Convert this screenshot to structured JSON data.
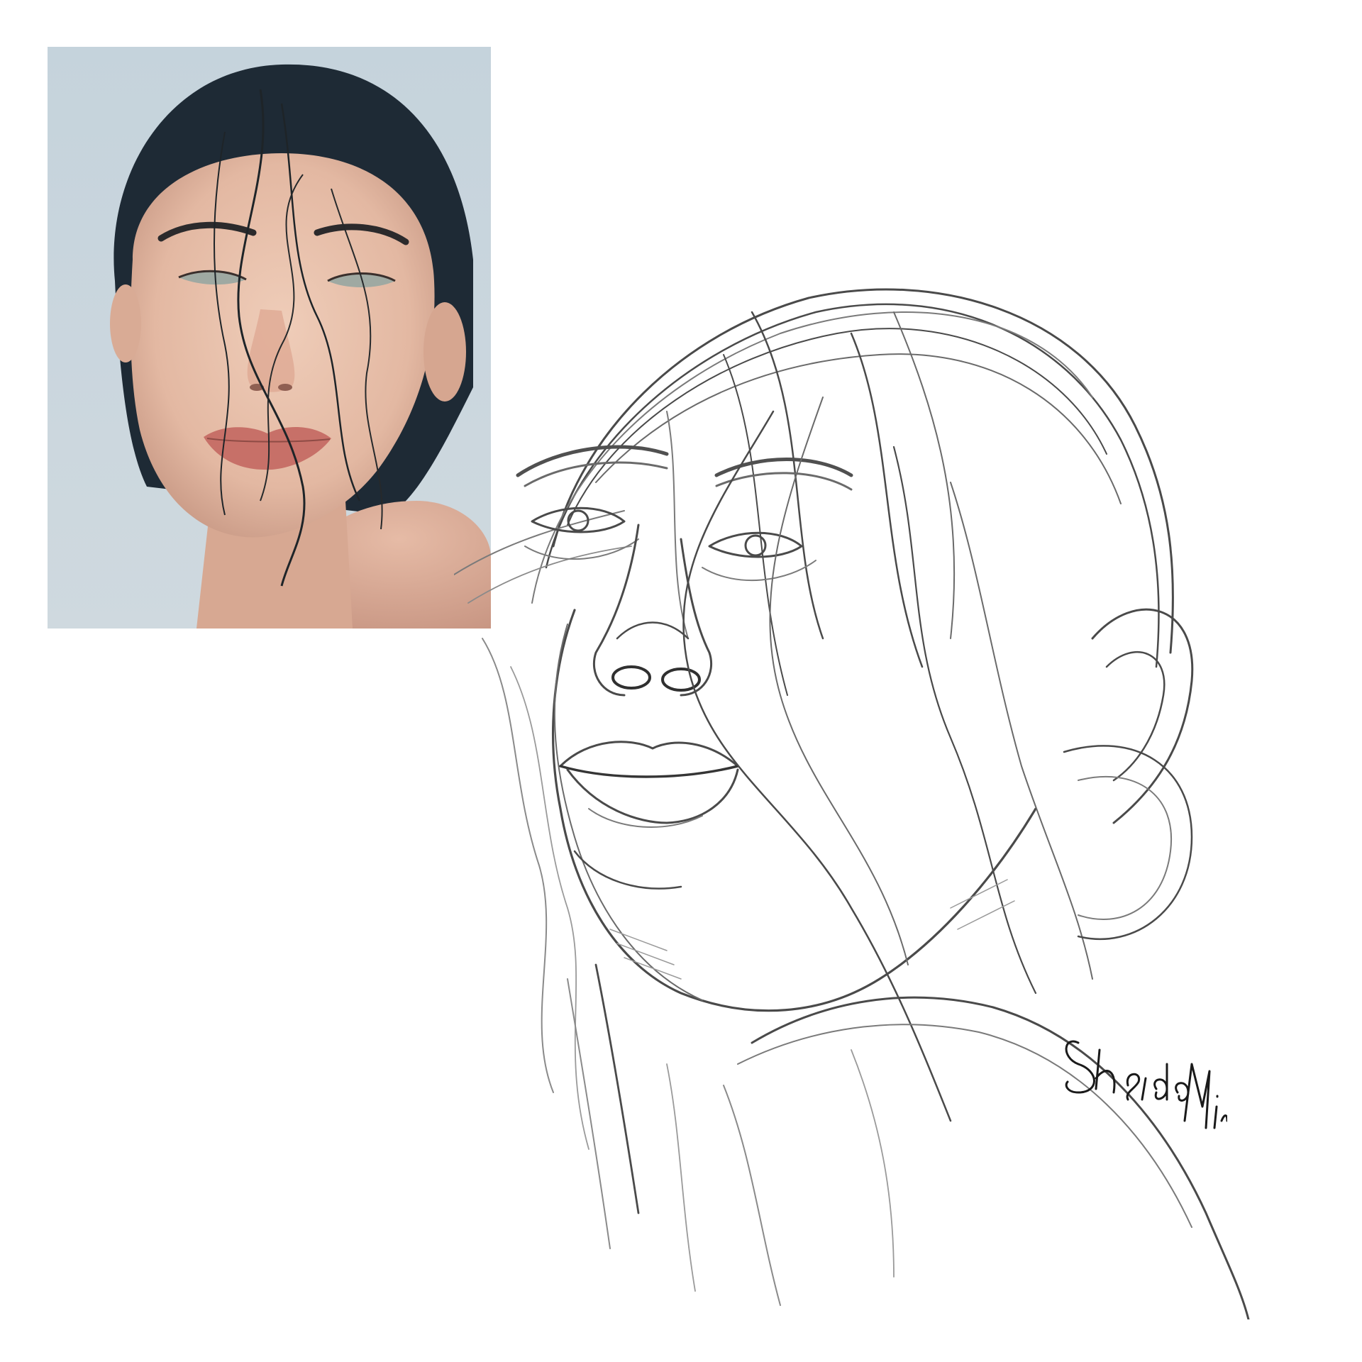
{
  "image": {
    "background": "#ffffff",
    "reference_photo": {
      "subject": "portrait-photo",
      "colors": {
        "sky": "#c9d6de",
        "hair": "#1e2a35",
        "skin": "#e8c2ad",
        "skin_shadow": "#c99a86",
        "lips": "#c77068",
        "shoulder": "#dcae98"
      }
    },
    "sketch": {
      "subject": "pencil-portrait-sketch",
      "stroke_color": "#4a4a4a",
      "light_stroke_color": "#9a9a9a"
    },
    "signature": {
      "text": "SheidaMir",
      "color": "#1a1a1a"
    }
  }
}
